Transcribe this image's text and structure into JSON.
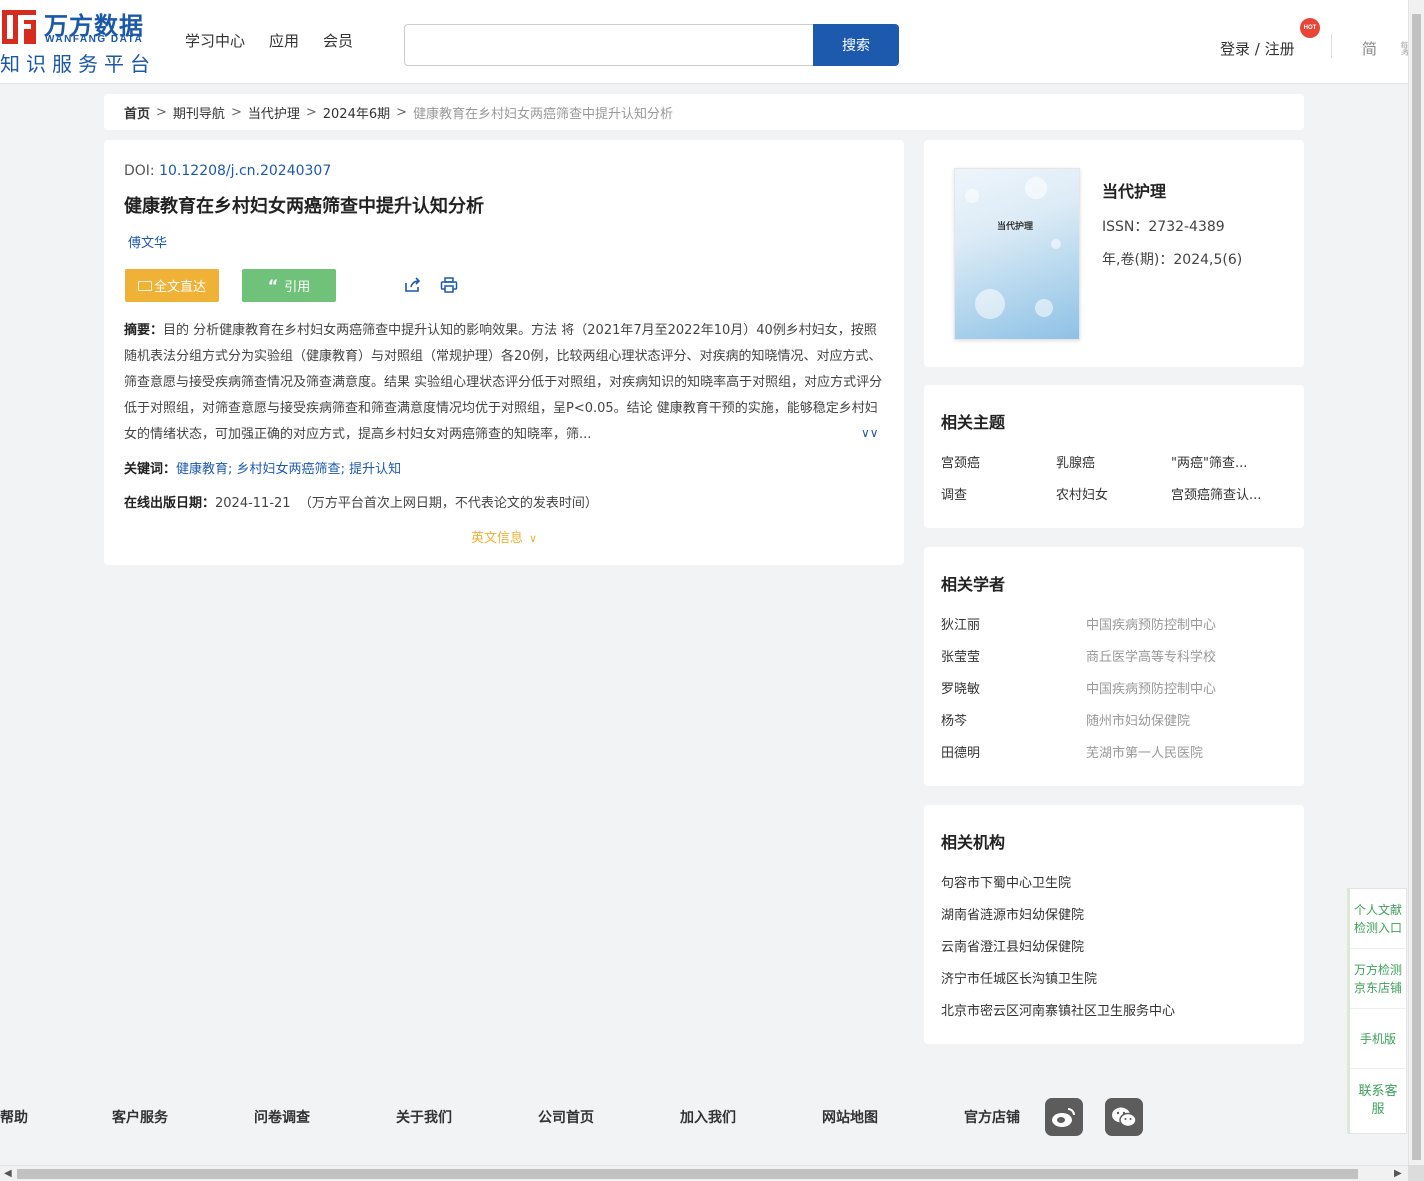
{
  "header": {
    "logo": {
      "cn": "万方数据",
      "en": "WANFANG DATA",
      "sub": "知识服务平台"
    },
    "nav": [
      "学习中心",
      "应用",
      "会员"
    ],
    "search": {
      "value": "",
      "placeholder": "",
      "button": "搜索"
    },
    "login": "登录 / 注册",
    "hot_badge": "HOT",
    "lang": "简",
    "lang2": "繁"
  },
  "breadcrumb": [
    "首页",
    "期刊导航",
    "当代护理",
    "2024年6期",
    "健康教育在乡村妇女两癌筛查中提升认知分析"
  ],
  "article": {
    "doi_label": "DOI: ",
    "doi": "10.12208/j.cn.20240307",
    "title": "健康教育在乡村妇女两癌筛查中提升认知分析",
    "author": "傅文华",
    "buttons": {
      "fulltext": "全文直达",
      "cite": "引用"
    },
    "abstract_label": "摘要：",
    "abstract": "目的 分析健康教育在乡村妇女两癌筛查中提升认知的影响效果。方法 将（2021年7月至2022年10月）40例乡村妇女，按照随机表法分组方式分为实验组（健康教育）与对照组（常规护理）各20例，比较两组心理状态评分、对疾病的知晓情况、对应方式、筛查意愿与接受疾病筛查情况及筛查满意度。结果 实验组心理状态评分低于对照组，对疾病知识的知晓率高于对照组，对应方式评分低于对照组，对筛查意愿与接受疾病筛查和筛查满意度情况均优于对照组，呈P<0.05。结论 健康教育干预的实施，能够稳定乡村妇女的情绪状态，可加强正确的对应方式，提高乡村妇女对两癌筛查的知晓率，筛...",
    "keywords_label": "关键词：",
    "keywords": [
      "健康教育",
      "乡村妇女两癌筛查",
      "提升认知"
    ],
    "pubdate_label": "在线出版日期：",
    "pubdate": "2024-11-21",
    "pubdate_note": "（万方平台首次上网日期，不代表论文的发表时间）",
    "english_info": "英文信息"
  },
  "journal": {
    "cover_title": "当代护理",
    "name": "当代护理",
    "issn": "ISSN：2732-4389",
    "volume": "年,卷(期)：2024,5(6)"
  },
  "topics": {
    "title": "相关主题",
    "items": [
      "宫颈癌",
      "乳腺癌",
      "\"两癌\"筛查...",
      "调查",
      "农村妇女",
      "宫颈癌筛查认..."
    ]
  },
  "scholars": {
    "title": "相关学者",
    "items": [
      {
        "name": "狄江丽",
        "org": "中国疾病预防控制中心"
      },
      {
        "name": "张莹莹",
        "org": "商丘医学高等专科学校"
      },
      {
        "name": "罗晓敏",
        "org": "中国疾病预防控制中心"
      },
      {
        "name": "杨芩",
        "org": "随州市妇幼保健院"
      },
      {
        "name": "田德明",
        "org": "芜湖市第一人民医院"
      }
    ]
  },
  "orgs": {
    "title": "相关机构",
    "items": [
      "句容市下蜀中心卫生院",
      "湖南省涟源市妇幼保健院",
      "云南省澄江县妇幼保健院",
      "济宁市任城区长沟镇卫生院",
      "北京市密云区河南寨镇社区卫生服务中心"
    ]
  },
  "float": [
    "个人文献检测入口",
    "万方检测京东店铺",
    "手机版",
    "联系客服"
  ],
  "footer": [
    "帮助",
    "客户服务",
    "问卷调查",
    "关于我们",
    "公司首页",
    "加入我们",
    "网站地图",
    "官方店铺"
  ],
  "colors": {
    "brand_blue": "#1d5aad",
    "logo_red": "#d62c1f",
    "accent_orange": "#f0b236",
    "accent_green": "#70c17a"
  }
}
